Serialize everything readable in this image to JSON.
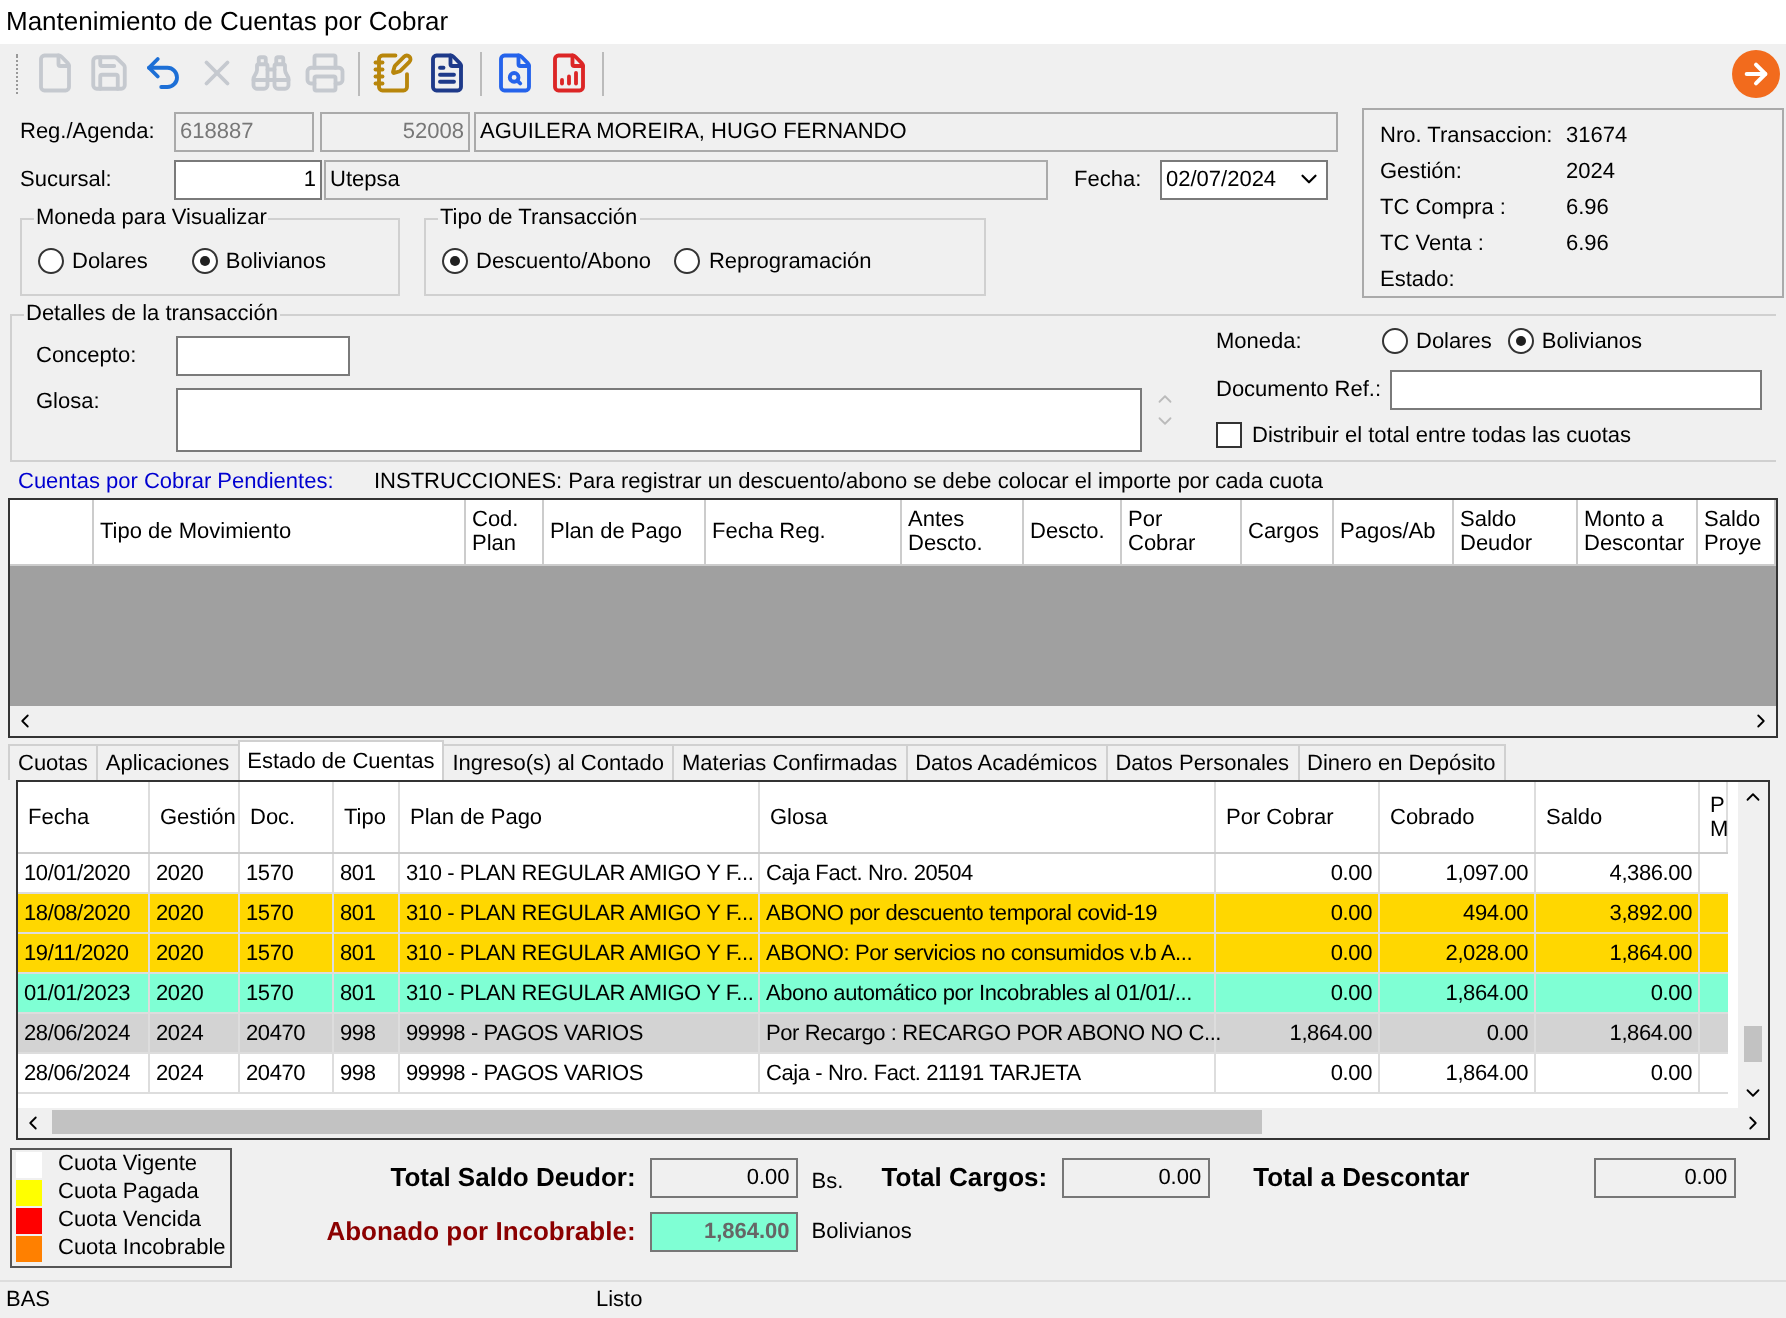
{
  "window": {
    "title": "Mantenimiento de Cuentas por Cobrar"
  },
  "toolbar": [
    {
      "kind": "new",
      "disabled": true
    },
    {
      "kind": "save",
      "disabled": true
    },
    {
      "kind": "undo",
      "disabled": false
    },
    {
      "kind": "delete",
      "disabled": true
    },
    {
      "kind": "find",
      "disabled": true
    },
    {
      "kind": "print",
      "disabled": true
    },
    {
      "kind": "edit",
      "disabled": false
    },
    {
      "kind": "list",
      "disabled": false
    },
    {
      "kind": "preview",
      "disabled": false
    },
    {
      "kind": "report",
      "disabled": false
    }
  ],
  "form": {
    "reg_label": "Reg./Agenda:",
    "reg_code": "618887",
    "reg_number": "52008",
    "reg_name": "AGUILERA MOREIRA, HUGO FERNANDO",
    "sucursal_label": "Sucursal:",
    "sucursal_value": "1",
    "sucursal_name": "Utepsa",
    "fecha_label": "Fecha:",
    "fecha_value": "02/07/2024"
  },
  "moneda_visualizar": {
    "title": "Moneda para Visualizar",
    "options": [
      {
        "label": "Dolares",
        "selected": false
      },
      {
        "label": "Bolivianos",
        "selected": true
      }
    ]
  },
  "tipo_transaccion": {
    "title": "Tipo de Transacción",
    "options": [
      {
        "label": "Descuento/Abono",
        "selected": true
      },
      {
        "label": "Reprogramación",
        "selected": false
      }
    ]
  },
  "info": [
    {
      "label": "Nro. Transaccion:",
      "value": "31674"
    },
    {
      "label": "Gestión:",
      "value": "2024"
    },
    {
      "label": "TC Compra :",
      "value": "6.96"
    },
    {
      "label": "TC Venta :",
      "value": "6.96"
    },
    {
      "label": "Estado:"
    }
  ],
  "detalles": {
    "title": "Detalles de la transacción",
    "concepto_label": "Concepto:",
    "glosa_label": "Glosa:",
    "moneda_label": "Moneda:",
    "moneda_options": [
      {
        "label": "Dolares",
        "selected": false
      },
      {
        "label": "Bolivianos",
        "selected": true
      }
    ],
    "documento_label": "Documento Ref.:",
    "distribuir": {
      "label": "Distribuir el total entre todas las cuotas",
      "checked": false
    }
  },
  "pendientes": {
    "title": "Cuentas por Cobrar Pendientes:",
    "instructions": "INSTRUCCIONES: Para registrar un descuento/abono se debe colocar el importe por cada cuota",
    "columns": [
      "Tipo de Movimiento",
      "Cod. Plan",
      "Plan de Pago",
      "Fecha Reg.",
      "Antes Descto.",
      "Descto.",
      "Por Cobrar",
      "Cargos",
      "Pagos/Ab",
      "Saldo Deudor",
      "Monto a Descontar",
      "Saldo Proye"
    ]
  },
  "tabs": [
    {
      "label": "Cuotas",
      "selected": false
    },
    {
      "label": "Aplicaciones",
      "selected": false
    },
    {
      "label": "Estado de Cuentas",
      "selected": true
    },
    {
      "label": "Ingreso(s) al Contado",
      "selected": false
    },
    {
      "label": "Materias Confirmadas",
      "selected": false
    },
    {
      "label": "Datos Académicos",
      "selected": false
    },
    {
      "label": "Datos Personales",
      "selected": false
    },
    {
      "label": "Dinero en Depósito",
      "selected": false
    }
  ],
  "estado": {
    "columns": [
      "Fecha",
      "Gestión",
      "Doc.",
      "Tipo",
      "Plan de Pago",
      "Glosa",
      "Por Cobrar",
      "Cobrado",
      "Saldo",
      "P M"
    ],
    "rows": [
      {
        "color": "#ffffff",
        "cells": [
          "10/01/2020",
          "2020",
          "1570",
          "801",
          "310 - PLAN REGULAR AMIGO Y F...",
          "Caja Fact. Nro. 20504",
          "0.00",
          "1,097.00",
          "4,386.00"
        ]
      },
      {
        "color": "#ffd700",
        "cells": [
          "18/08/2020",
          "2020",
          "1570",
          "801",
          "310 - PLAN REGULAR AMIGO Y F...",
          "ABONO por descuento temporal covid-19",
          "0.00",
          "494.00",
          "3,892.00"
        ]
      },
      {
        "color": "#ffd700",
        "cells": [
          "19/11/2020",
          "2020",
          "1570",
          "801",
          "310 - PLAN REGULAR AMIGO Y F...",
          "ABONO: Por servicios no consumidos v.b A...",
          "0.00",
          "2,028.00",
          "1,864.00"
        ]
      },
      {
        "color": "#7fffd4",
        "cells": [
          "01/01/2023",
          "2020",
          "1570",
          "801",
          "310 - PLAN REGULAR AMIGO Y F...",
          "Abono automático por Incobrables al 01/01/...",
          "0.00",
          "1,864.00",
          "0.00"
        ]
      },
      {
        "color": "#d3d3d3",
        "cells": [
          "28/06/2024",
          "2024",
          "20470",
          "998",
          "99998 - PAGOS VARIOS",
          "Por Recargo : RECARGO POR ABONO NO C...",
          "1,864.00",
          "0.00",
          "1,864.00"
        ]
      },
      {
        "color": "#ffffff",
        "cells": [
          "28/06/2024",
          "2024",
          "20470",
          "998",
          "99998 - PAGOS VARIOS",
          "Caja - Nro. Fact. 21191 TARJETA",
          "0.00",
          "1,864.00",
          "0.00"
        ]
      }
    ]
  },
  "legend": [
    {
      "label": "Cuota Vigente",
      "color": "#ffffff"
    },
    {
      "label": "Cuota Pagada",
      "color": "#ffff00"
    },
    {
      "label": "Cuota Vencida",
      "color": "#ff0000"
    },
    {
      "label": "Cuota Incobrable",
      "color": "#ff8000"
    }
  ],
  "totals": {
    "saldo_label": "Total Saldo Deudor:",
    "saldo_value": "0.00",
    "saldo_unit": "Bs.",
    "cargos_label": "Total Cargos:",
    "cargos_value": "0.00",
    "descontar_label": "Total a Descontar",
    "descontar_value": "0.00",
    "incobrable_label": "Abonado por Incobrable:",
    "incobrable_value": "1,864.00",
    "incobrable_unit": "Bolivianos"
  },
  "status_bar": [
    "BAS",
    "Listo"
  ]
}
